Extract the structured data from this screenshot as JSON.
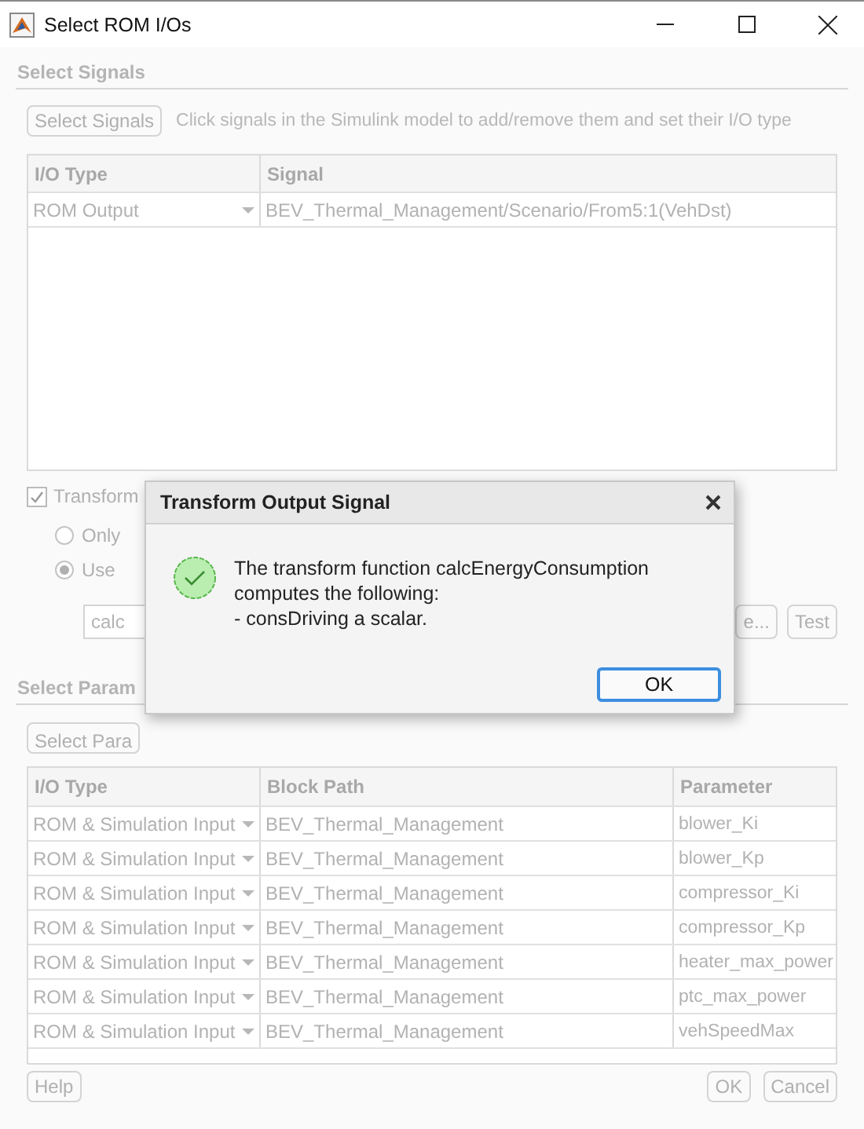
{
  "window": {
    "title": "Select ROM I/Os"
  },
  "signals": {
    "heading": "Select Signals",
    "select_button": "Select Signals",
    "hint": "Click signals in the Simulink model to add/remove them and set their I/O type",
    "table": {
      "columns": [
        "I/O Type",
        "Signal"
      ],
      "rows": [
        {
          "io_type": "ROM Output",
          "signal": "BEV_Thermal_Management/Scenario/From5:1(VehDst)"
        }
      ]
    }
  },
  "transform": {
    "label": "Transform",
    "checked": true,
    "options": [
      {
        "label": "Only",
        "selected": false
      },
      {
        "label": "Use",
        "selected": true
      }
    ],
    "function_field": {
      "value": "calc"
    },
    "buttons": [
      "e...",
      "Test"
    ]
  },
  "parameters": {
    "heading": "Select Param",
    "select_button": "Select Para",
    "table": {
      "columns": [
        "I/O Type",
        "Block Path",
        "Parameter"
      ],
      "rows": [
        {
          "io_type": "ROM & Simulation Input",
          "block_path": "BEV_Thermal_Management",
          "parameter": "blower_Ki"
        },
        {
          "io_type": "ROM & Simulation Input",
          "block_path": "BEV_Thermal_Management",
          "parameter": "blower_Kp"
        },
        {
          "io_type": "ROM & Simulation Input",
          "block_path": "BEV_Thermal_Management",
          "parameter": "compressor_Ki"
        },
        {
          "io_type": "ROM & Simulation Input",
          "block_path": "BEV_Thermal_Management",
          "parameter": "compressor_Kp"
        },
        {
          "io_type": "ROM & Simulation Input",
          "block_path": "BEV_Thermal_Management",
          "parameter": "heater_max_power"
        },
        {
          "io_type": "ROM & Simulation Input",
          "block_path": "BEV_Thermal_Management",
          "parameter": "ptc_max_power"
        },
        {
          "io_type": "ROM & Simulation Input",
          "block_path": "BEV_Thermal_Management",
          "parameter": "vehSpeedMax"
        }
      ]
    }
  },
  "footer": {
    "buttons": [
      "Help",
      "OK",
      "Cancel"
    ]
  },
  "dialog": {
    "title": "Transform Output Signal",
    "message": "The transform function calcEnergyConsumption\ncomputes the following:\n- consDriving a scalar.",
    "ok_button": "OK"
  }
}
